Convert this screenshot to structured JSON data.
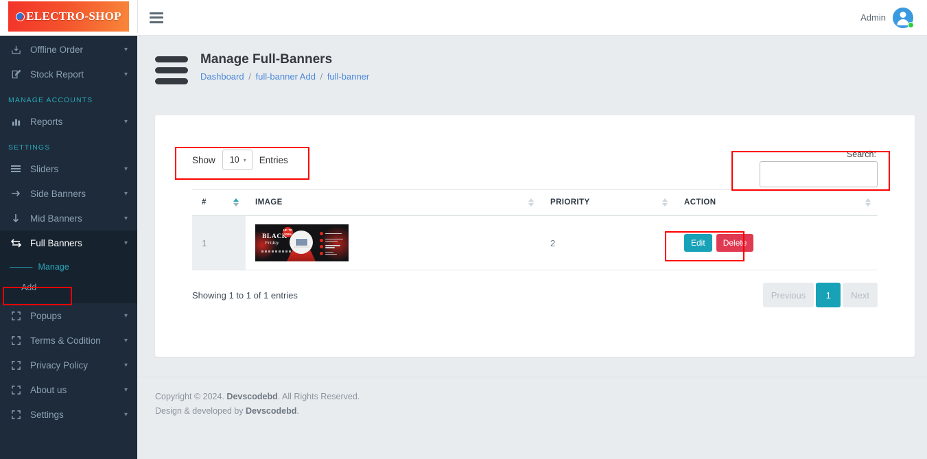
{
  "brand": {
    "name": "ELECTRO-SHOP",
    "globe_icon": "globe-e-icon",
    "gradient_from": "#f3332a",
    "gradient_to": "#f8873a"
  },
  "sidebar": {
    "items": [
      {
        "label": "Offline Order",
        "icon": "download-box-icon",
        "caret": "⌄",
        "active": false
      },
      {
        "label": "Stock Report",
        "icon": "edit-square-icon",
        "caret": "⌄",
        "active": false
      }
    ],
    "sections": [
      {
        "title": "MANAGE ACCOUNTS"
      },
      {
        "title": "SETTINGS"
      }
    ],
    "accounts_items": [
      {
        "label": "Reports",
        "icon": "bar-chart-icon",
        "caret": "⌄",
        "active": false
      }
    ],
    "settings_items": [
      {
        "label": "Sliders",
        "icon": "bars-icon",
        "caret": "⌄",
        "active": false
      },
      {
        "label": "Side Banners",
        "icon": "arrow-right-icon",
        "caret": "⌄",
        "active": false
      },
      {
        "label": "Mid Banners",
        "icon": "arrow-down-icon",
        "caret": "⌄",
        "active": false
      },
      {
        "label": "Full Banners",
        "icon": "exchange-arrows-icon",
        "caret": "⌄",
        "active": true
      },
      {
        "label": "Popups",
        "icon": "expand-icon",
        "caret": "⌄",
        "active": false
      },
      {
        "label": "Terms & Codition",
        "icon": "expand-icon",
        "caret": "⌄",
        "active": false
      },
      {
        "label": "Privacy Policy",
        "icon": "expand-icon",
        "caret": "⌄",
        "active": false
      },
      {
        "label": "About us",
        "icon": "expand-icon",
        "caret": "⌄",
        "active": false
      },
      {
        "label": "Settings",
        "icon": "expand-icon",
        "caret": "⌄",
        "active": false
      }
    ],
    "submenu": [
      {
        "label": "Manage",
        "active": true
      },
      {
        "label": "Add",
        "active": false
      }
    ],
    "active_color": "#2aa7b8"
  },
  "topbar": {
    "menu_icon": "hamburger-icon",
    "user_name": "Admin",
    "avatar_icon": "user-avatar-icon",
    "status_color": "#2ecc40"
  },
  "page": {
    "title": "Manage Full-Banners",
    "breadcrumb": [
      {
        "label": "Dashboard"
      },
      {
        "label": "full-banner Add"
      },
      {
        "label": "full-banner"
      }
    ],
    "breadcrumb_sep": "/"
  },
  "table_controls": {
    "show_label": "Show",
    "length_value": "10",
    "length_caret": "▾",
    "entries_label": "Entries",
    "search_label": "Search:",
    "search_value": "",
    "search_placeholder": ""
  },
  "table": {
    "columns": [
      {
        "label": "#",
        "sort": "asc"
      },
      {
        "label": "IMAGE",
        "sort": "none"
      },
      {
        "label": "PRIORITY",
        "sort": "none"
      },
      {
        "label": "ACTION",
        "sort": "none"
      }
    ],
    "rows": [
      {
        "id": "1",
        "image": {
          "alt": "black-friday-banner-thumbnail",
          "title": "BLACK",
          "subtitle": "Friday",
          "badge_top": "UP TO",
          "badge_bottom": "200%"
        },
        "priority": "2",
        "actions": [
          {
            "label": "Edit",
            "style": "edit"
          },
          {
            "label": "Delete",
            "style": "delete"
          }
        ]
      }
    ]
  },
  "table_footer": {
    "info": "Showing 1 to 1 of 1 entries",
    "pagination": [
      {
        "label": "Previous",
        "state": "disabled"
      },
      {
        "label": "1",
        "state": "current"
      },
      {
        "label": "Next",
        "state": "disabled"
      }
    ]
  },
  "footer": {
    "line1_pre": "Copyright © 2024. ",
    "line1_brand": "Devscodebd",
    "line1_post": ". All Rights Reserved.",
    "line2_pre": "Design & developed by ",
    "line2_brand": "Devscodebd",
    "line2_post": "."
  },
  "annotations": {
    "highlight_color": "#ff0000",
    "boxes": [
      "manage-menu-item",
      "show-entries-control",
      "search-box",
      "row-action-buttons"
    ]
  }
}
